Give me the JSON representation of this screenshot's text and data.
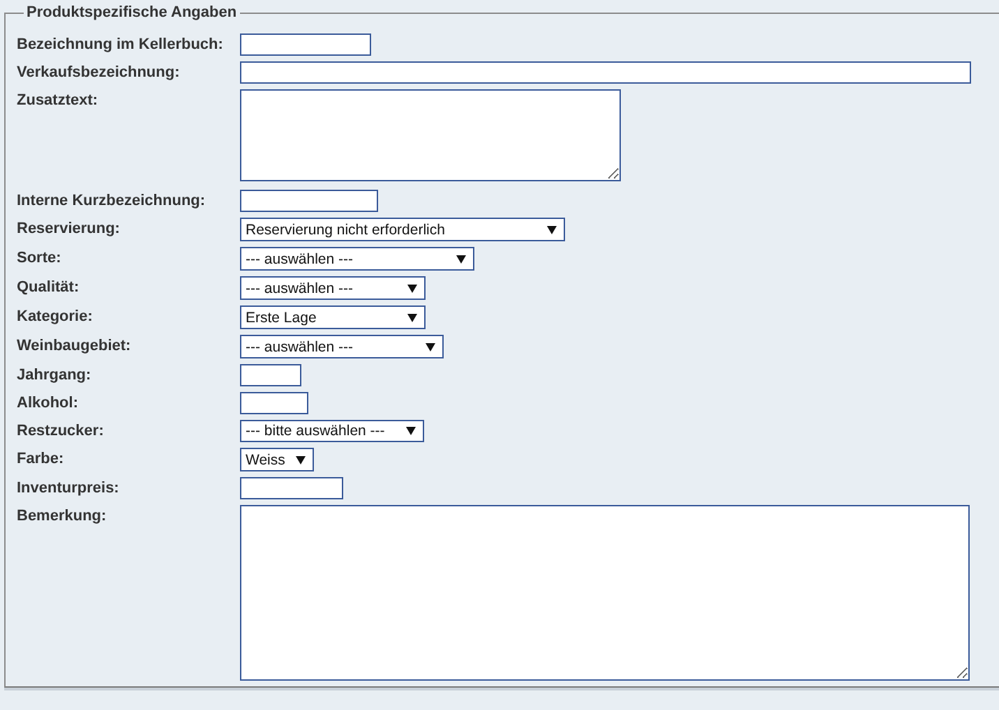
{
  "fieldset": {
    "legend": "Produktspezifische Angaben"
  },
  "fields": [
    {
      "label": "Bezeichnung im Kellerbuch:",
      "kind": "text"
    },
    {
      "label": "Verkaufsbezeichnung:",
      "kind": "text"
    },
    {
      "label": "Zusatztext:",
      "kind": "textarea"
    },
    {
      "label": "Interne Kurzbezeichnung:",
      "kind": "text"
    },
    {
      "label": "Reservierung:",
      "kind": "select",
      "value": "Reservierung nicht erforderlich"
    },
    {
      "label": "Sorte:",
      "kind": "select",
      "value": "--- auswählen ---"
    },
    {
      "label": "Qualität:",
      "kind": "select",
      "value": "--- auswählen ---"
    },
    {
      "label": "Kategorie:",
      "kind": "select",
      "value": "Erste Lage"
    },
    {
      "label": "Weinbaugebiet:",
      "kind": "select",
      "value": "--- auswählen ---"
    },
    {
      "label": "Jahrgang:",
      "kind": "text"
    },
    {
      "label": "Alkohol:",
      "kind": "text"
    },
    {
      "label": "Restzucker:",
      "kind": "select",
      "value": "--- bitte auswählen ---"
    },
    {
      "label": "Farbe:",
      "kind": "select",
      "value": "Weiss"
    },
    {
      "label": "Inventurpreis:",
      "kind": "text"
    },
    {
      "label": "Bemerkung:",
      "kind": "textarea"
    }
  ]
}
